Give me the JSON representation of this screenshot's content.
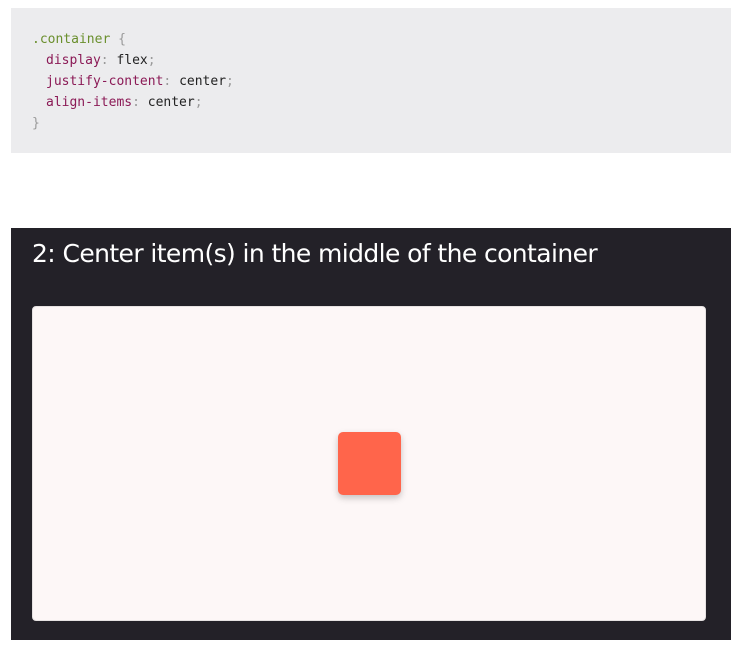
{
  "code": {
    "selector": ".container",
    "open_brace": "{",
    "close_brace": "}",
    "declarations": [
      {
        "property": "display",
        "value": "flex"
      },
      {
        "property": "justify-content",
        "value": "center"
      },
      {
        "property": "align-items",
        "value": "center"
      }
    ],
    "colon": ":",
    "semicolon": ";"
  },
  "demo": {
    "title": "2: Center item(s) in the middle of the container",
    "item_color": "#ff654b",
    "panel_color": "#232128",
    "container_color": "#fdf7f7"
  }
}
